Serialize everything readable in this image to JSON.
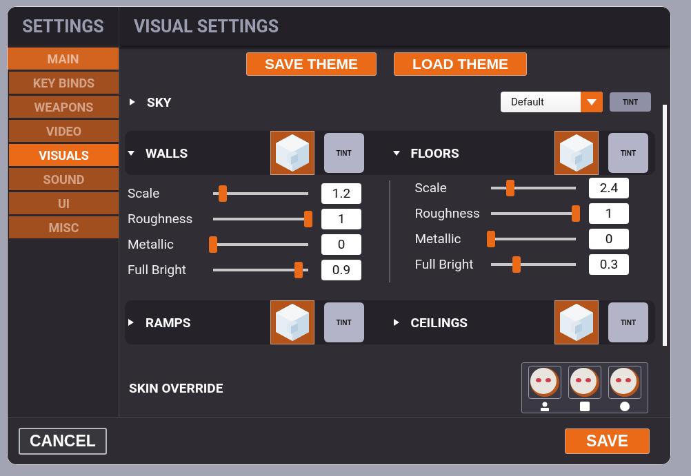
{
  "sidebar": {
    "title": "SETTINGS",
    "items": [
      {
        "label": "MAIN",
        "selected": false,
        "hovered": true
      },
      {
        "label": "KEY BINDS",
        "selected": false,
        "hovered": false
      },
      {
        "label": "WEAPONS",
        "selected": false,
        "hovered": false
      },
      {
        "label": "VIDEO",
        "selected": false,
        "hovered": false
      },
      {
        "label": "VISUALS",
        "selected": true,
        "hovered": false
      },
      {
        "label": "SOUND",
        "selected": false,
        "hovered": false
      },
      {
        "label": "UI",
        "selected": false,
        "hovered": false
      },
      {
        "label": "MISC",
        "selected": false,
        "hovered": false
      }
    ]
  },
  "header": {
    "title": "VISUAL SETTINGS"
  },
  "theme_buttons": [
    "SAVE THEME",
    "LOAD THEME"
  ],
  "sky": {
    "label": "SKY",
    "expanded": false,
    "dropdown": "Default",
    "tint": "TINT"
  },
  "material_rows": [
    {
      "groups": [
        {
          "label": "WALLS",
          "expanded": true,
          "tint": "TINT",
          "sliders": [
            {
              "label": "Scale",
              "level": 0.1,
              "value": "1.2"
            },
            {
              "label": "Roughness",
              "level": 1,
              "value": "1"
            },
            {
              "label": "Metallic",
              "level": 0,
              "value": "0"
            },
            {
              "label": "Full Bright",
              "level": 0.9,
              "value": "0.9"
            }
          ]
        },
        {
          "label": "FLOORS",
          "expanded": true,
          "tint": "TINT",
          "sliders": [
            {
              "label": "Scale",
              "level": 0.23,
              "value": "2.4"
            },
            {
              "label": "Roughness",
              "level": 1,
              "value": "1"
            },
            {
              "label": "Metallic",
              "level": 0,
              "value": "0"
            },
            {
              "label": "Full Bright",
              "level": 0.3,
              "value": "0.3"
            }
          ]
        }
      ]
    },
    {
      "groups": [
        {
          "label": "RAMPS",
          "expanded": false,
          "tint": "TINT"
        },
        {
          "label": "CEILINGS",
          "expanded": false,
          "tint": "TINT"
        }
      ]
    }
  ],
  "skin_override": {
    "label": "SKIN OVERRIDE",
    "skins": [
      {
        "kind": "person"
      },
      {
        "kind": "square"
      },
      {
        "kind": "circle"
      }
    ]
  },
  "footer": {
    "cancel": "CANCEL",
    "save": "SAVE"
  }
}
